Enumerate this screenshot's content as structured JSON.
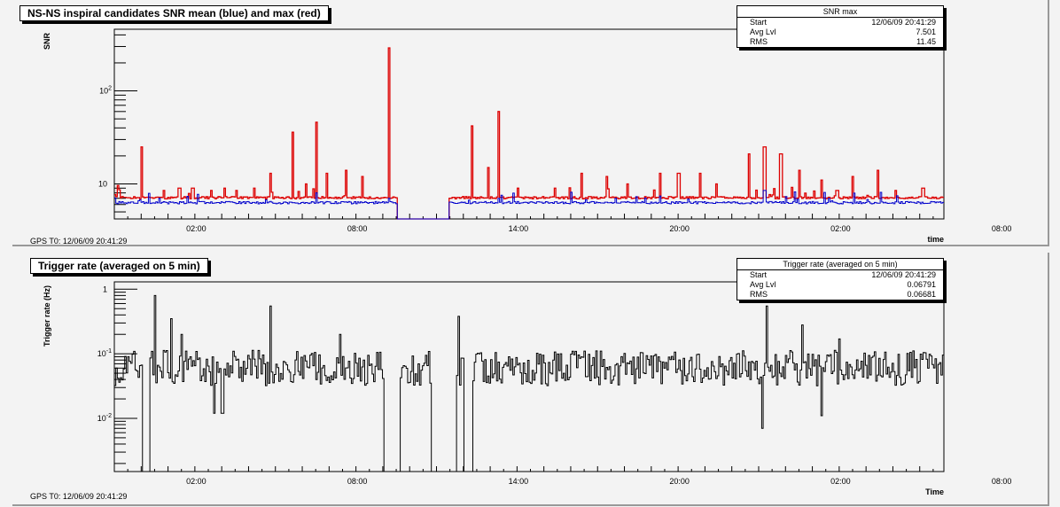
{
  "gps_label": "GPS T0: 12/06/09 20:41:29",
  "chart_data": [
    {
      "type": "line",
      "title": "NS-NS inspiral candidates SNR mean (blue) and max (red)",
      "xlabel": "time",
      "ylabel": "SNR",
      "yscale": "log",
      "ylim": [
        4.2,
        460
      ],
      "xlim": [
        0,
        30.9
      ],
      "x_tick_labels": [
        "02:00",
        "08:00",
        "14:00",
        "20:00",
        "02:00",
        "08:00",
        "14:00",
        "20:00",
        "02:00"
      ],
      "y_tick_labels": [
        {
          "base": "10",
          "exp": "2"
        },
        {
          "base": "10",
          "exp": ""
        }
      ],
      "colors": {
        "max": "#dd0000",
        "mean": "#0000cc"
      },
      "stats": {
        "header": "SNR max",
        "rows": [
          [
            "Start",
            "12/06/09 20:41:29"
          ],
          [
            "Avg Lvl",
            "7.501"
          ],
          [
            "RMS",
            "11.45"
          ]
        ]
      },
      "gaps": [
        [
          0.35,
          0.35
        ],
        [
          10.5,
          12.0
        ],
        [
          12.0,
          12.45
        ]
      ],
      "series": [
        {
          "key": "max",
          "baseline": 6.9,
          "spikes": [
            [
              0.1,
              9.6
            ],
            [
              1.0,
              25
            ],
            [
              1.8,
              8.5
            ],
            [
              2.4,
              9
            ],
            [
              2.9,
              9
            ],
            [
              3.6,
              8.5
            ],
            [
              4.1,
              9
            ],
            [
              5.2,
              9
            ],
            [
              5.8,
              13
            ],
            [
              6.6,
              36
            ],
            [
              7.1,
              10
            ],
            [
              7.5,
              46
            ],
            [
              7.9,
              13
            ],
            [
              8.6,
              14
            ],
            [
              9.2,
              12
            ],
            [
              10.2,
              290
            ],
            [
              12.3,
              18
            ],
            [
              13.3,
              42
            ],
            [
              13.9,
              15
            ],
            [
              14.3,
              60
            ],
            [
              15.0,
              9
            ],
            [
              16.4,
              9
            ],
            [
              17.4,
              13
            ],
            [
              18.3,
              12
            ],
            [
              19.1,
              10
            ],
            [
              20.3,
              13
            ],
            [
              21.0,
              13
            ],
            [
              21.8,
              13
            ],
            [
              22.4,
              10
            ],
            [
              23.6,
              21
            ],
            [
              24.2,
              25
            ],
            [
              24.8,
              21
            ],
            [
              25.5,
              14
            ],
            [
              26.3,
              11
            ],
            [
              26.9,
              8.5
            ],
            [
              27.5,
              12
            ],
            [
              28.4,
              14
            ],
            [
              29.1,
              8.5
            ],
            [
              30.1,
              9
            ]
          ]
        },
        {
          "key": "mean",
          "baseline": 6.1,
          "spikes": [
            [
              7.5,
              8
            ],
            [
              10.2,
              7
            ],
            [
              14.3,
              7
            ],
            [
              24.2,
              8.5
            ]
          ]
        }
      ]
    },
    {
      "type": "line",
      "title": "Trigger rate (averaged on 5 min)",
      "xlabel": "Time",
      "ylabel": "Trigger rate (Hz)",
      "yscale": "log",
      "ylim": [
        0.0015,
        1.3
      ],
      "xlim": [
        0,
        30.9
      ],
      "x_tick_labels": [
        "02:00",
        "08:00",
        "14:00",
        "20:00",
        "02:00",
        "08:00",
        "14:00",
        "20:00",
        "02:00"
      ],
      "y_tick_labels": [
        {
          "base": "1",
          "exp": ""
        },
        {
          "base": "10",
          "exp": "-1"
        },
        {
          "base": "10",
          "exp": "-2"
        }
      ],
      "colors": {
        "line": "#000000"
      },
      "stats": {
        "header": "Trigger rate (averaged on 5 min)",
        "rows": [
          [
            "Start",
            "12/06/09 20:41:29"
          ],
          [
            "Avg Lvl",
            "0.06791"
          ],
          [
            "RMS",
            "0.06681"
          ]
        ]
      },
      "gaps": [
        [
          1.0,
          1.3
        ],
        [
          10.0,
          10.6
        ],
        [
          11.8,
          12.7
        ],
        [
          13.0,
          13.3
        ]
      ],
      "series": [
        {
          "key": "rate",
          "baseline": 0.06,
          "spikes": [
            [
              1.5,
              0.8
            ],
            [
              2.1,
              0.35
            ],
            [
              2.5,
              0.2
            ],
            [
              5.8,
              0.55
            ],
            [
              8.4,
              0.2
            ],
            [
              12.8,
              0.38
            ],
            [
              24.3,
              0.55
            ],
            [
              25.6,
              0.28
            ],
            [
              27.0,
              0.17
            ]
          ],
          "dips": [
            [
              3.7,
              0.012
            ],
            [
              4.0,
              0.012
            ],
            [
              24.1,
              0.007
            ],
            [
              26.3,
              0.011
            ]
          ]
        }
      ]
    }
  ]
}
